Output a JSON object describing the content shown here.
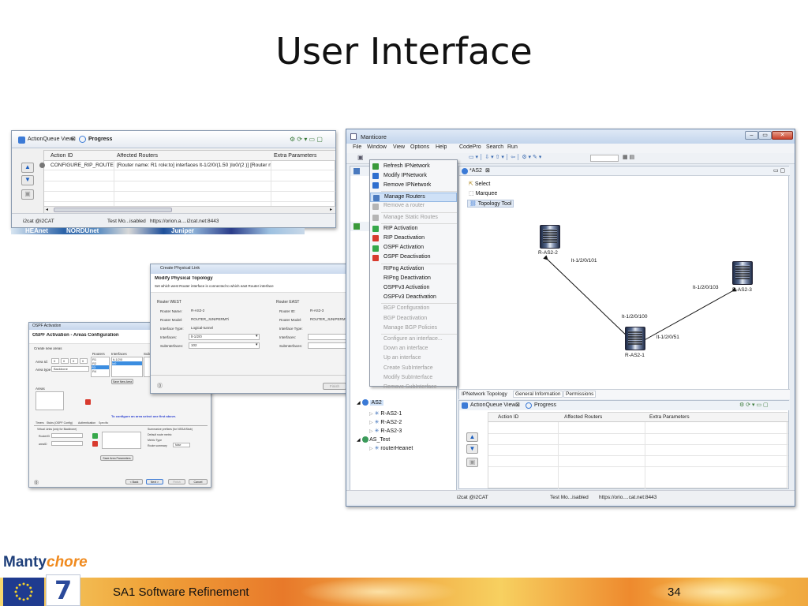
{
  "slide": {
    "title": "User Interface",
    "footer_text": "SA1 Software Refinement",
    "page_number": "34",
    "logo_text_1": "Manty",
    "logo_text_2": "chore",
    "colors": {
      "footer_orange": "#f0a43a",
      "logo_blue": "#1e3f7a",
      "logo_orange": "#f08a1e",
      "eu_blue": "#1f3b8f",
      "eu_star": "#f6d22a"
    }
  },
  "left_window": {
    "tab_actionqueue": "ActionQueue View",
    "tab_progress": "Progress",
    "columns": [
      "Action ID",
      "Affected Routers",
      "Extra Parameters"
    ],
    "row_action_id": "CONFIGURE_RIP_ROUTE",
    "row_routers": "[Router name: R1 role:to]  interfaces lt-1/2/0/(1.50 )lo0/(2 )] [Router na...",
    "status": [
      "i2cat @i2CAT",
      "Test Mo...isabled",
      "https://orion.a....i2cat.net:8443"
    ],
    "logo_strip": [
      "HEAnet",
      "NORDUnet",
      "Juniper"
    ]
  },
  "physlink_dialog": {
    "window_title": "Create Physical Link",
    "heading": "Modify Physical Topology",
    "subtitle": "Set which west Router interface is connected to which east Router interface",
    "west": {
      "group": "Router WEST",
      "name_label": "Router Name:",
      "name_value": "R-AS2-2",
      "model_label": "Router Model:",
      "model_value": "ROUTER_JUNIPERMTi",
      "itype_label": "Interface Type:",
      "itype_value": "Logical-tunnel",
      "iface_label": "Interfaces:",
      "iface_value": "lt-1/2/0",
      "sub_label": "SubInterfaces:",
      "sub_value": "102"
    },
    "east": {
      "group": "Router EAST",
      "id_label": "Router ID:",
      "id_value": "R-AS2-3",
      "model_label": "Router Model:",
      "model_value": "ROUTER_JUNIPERMTi",
      "itype_label": "Interface Type:",
      "iface_label": "Interfaces:",
      "sub_label": "SubInterfaces:"
    },
    "finish_label": "Finish",
    "cancel_label": "Cancel"
  },
  "ospf_dialog": {
    "window_title": "OSPF Activation",
    "heading": "OSPF Activation - Areas Configuration",
    "create_label": "Create new areas",
    "routers_label": "Routers",
    "interfaces_label": "Interfaces",
    "sub_label": "Sub",
    "area_id_label": "Area Id:",
    "area_id_values": [
      "0",
      "0",
      "0",
      "0"
    ],
    "area_type_label": "Area type",
    "area_type_value": "Backbone",
    "routers_list": [
      "R1",
      "R2",
      "R3",
      "R4"
    ],
    "interfaces_list": [
      "lt-1/2/0",
      "lo0"
    ],
    "save_area_label": "Save New Area",
    "areas_label": "Areas",
    "info_text": "To configure an area select one first above.",
    "tabs": [
      "Timers",
      "Stubs (OSPF Config)",
      "Authentication",
      "Specific"
    ],
    "virtual_links_label": "Virtual Links (only for Backbone)",
    "summarize_label": "Summarize prefixes (for NSSA/Stub)",
    "default_route_label": "Default route metric",
    "metric_type_label": "Metric Type",
    "route_summary_label": "Route summary",
    "route_summary_value": "false",
    "router_id_label": "RouterID",
    "area_id2_label": "areaID",
    "save_params_label": "Save Area Parameters",
    "back_label": "< Back",
    "next_label": "Next >",
    "finish_label": "Finish",
    "cancel_label": "Cancel"
  },
  "manticore": {
    "window_title": "Manticore",
    "menu": [
      "File",
      "Window",
      "View",
      "Options",
      "Help",
      "CodePro",
      "Search",
      "Run"
    ],
    "context_menu": [
      {
        "label": "Refresh IPNetwork",
        "disabled": false,
        "icon": "refresh-icon",
        "color": "#3a9a3a"
      },
      {
        "label": "Modify IPNetwork",
        "disabled": false,
        "icon": "network-icon",
        "color": "#2f6fcf"
      },
      {
        "label": "Remove IPNetwork",
        "disabled": false,
        "icon": "network-remove-icon",
        "color": "#2f6fcf"
      },
      {
        "label": "Manage Routers",
        "disabled": false,
        "icon": "router-icon",
        "color": "#4a7abf"
      },
      {
        "label": "Remove a router",
        "disabled": true,
        "icon": "router-remove-icon",
        "color": "#b5b5b5"
      },
      {
        "label": "Manage Static Routes",
        "disabled": true,
        "icon": "route-icon",
        "color": "#b5b5b5"
      },
      {
        "label": "RIP Activation",
        "disabled": false,
        "icon": "rip-on-icon",
        "color": "#36a84a"
      },
      {
        "label": "RIP Deactivation",
        "disabled": false,
        "icon": "rip-off-icon",
        "color": "#d83a2e"
      },
      {
        "label": "OSPF Activation",
        "disabled": false,
        "icon": "ospf-on-icon",
        "color": "#36a84a"
      },
      {
        "label": "OSPF Deactivation",
        "disabled": false,
        "icon": "ospf-off-icon",
        "color": "#d83a2e"
      },
      {
        "label": "RIPng Activation",
        "disabled": false,
        "icon": "",
        "color": ""
      },
      {
        "label": "RIPng Deactivation",
        "disabled": false,
        "icon": "",
        "color": ""
      },
      {
        "label": "OSPFv3 Activation",
        "disabled": false,
        "icon": "",
        "color": ""
      },
      {
        "label": "OSPFv3 Deactivation",
        "disabled": false,
        "icon": "",
        "color": ""
      },
      {
        "label": "BGP Configuration",
        "disabled": true,
        "icon": "",
        "color": ""
      },
      {
        "label": "BGP Deactivation",
        "disabled": true,
        "icon": "",
        "color": ""
      },
      {
        "label": "Manage BGP Policies",
        "disabled": true,
        "icon": "",
        "color": ""
      },
      {
        "label": "Configure an interface...",
        "disabled": true,
        "icon": "",
        "color": ""
      },
      {
        "label": "Down an interface",
        "disabled": true,
        "icon": "",
        "color": ""
      },
      {
        "label": "Up an interface",
        "disabled": true,
        "icon": "",
        "color": ""
      },
      {
        "label": "Create SubInterface",
        "disabled": true,
        "icon": "",
        "color": ""
      },
      {
        "label": "Modify SubInterface",
        "disabled": true,
        "icon": "",
        "color": ""
      },
      {
        "label": "Remove SubInterface",
        "disabled": true,
        "icon": "",
        "color": ""
      }
    ],
    "editor_tab": "*AS2",
    "palette": [
      "Select",
      "Marquee",
      "Topology Tool"
    ],
    "topology": {
      "routers": [
        {
          "name": "R-AS2-2"
        },
        {
          "name": "R-AS2-3"
        },
        {
          "name": "R-AS2-1"
        }
      ],
      "links": [
        "lt-1/2/0/101",
        "lt-1/2/0/103",
        "lt-1/2/0/100",
        "lt-1/2/0/51"
      ]
    },
    "bottom_tabs": [
      "IPNetwork Topology",
      "General Information",
      "Permissions"
    ],
    "tree": [
      "AS2",
      "R-AS2-1",
      "R-AS2-2",
      "R-AS2-3",
      "AS_Test",
      "routerHeanet"
    ],
    "aq_tab": "ActionQueue View",
    "progress_tab": "Progress",
    "aq_columns": [
      "Action ID",
      "Affected Routers",
      "Extra Parameters"
    ],
    "status": [
      "i2cat @i2CAT",
      "Test Mo...isabled",
      "https://orio....cat.net:8443"
    ]
  }
}
